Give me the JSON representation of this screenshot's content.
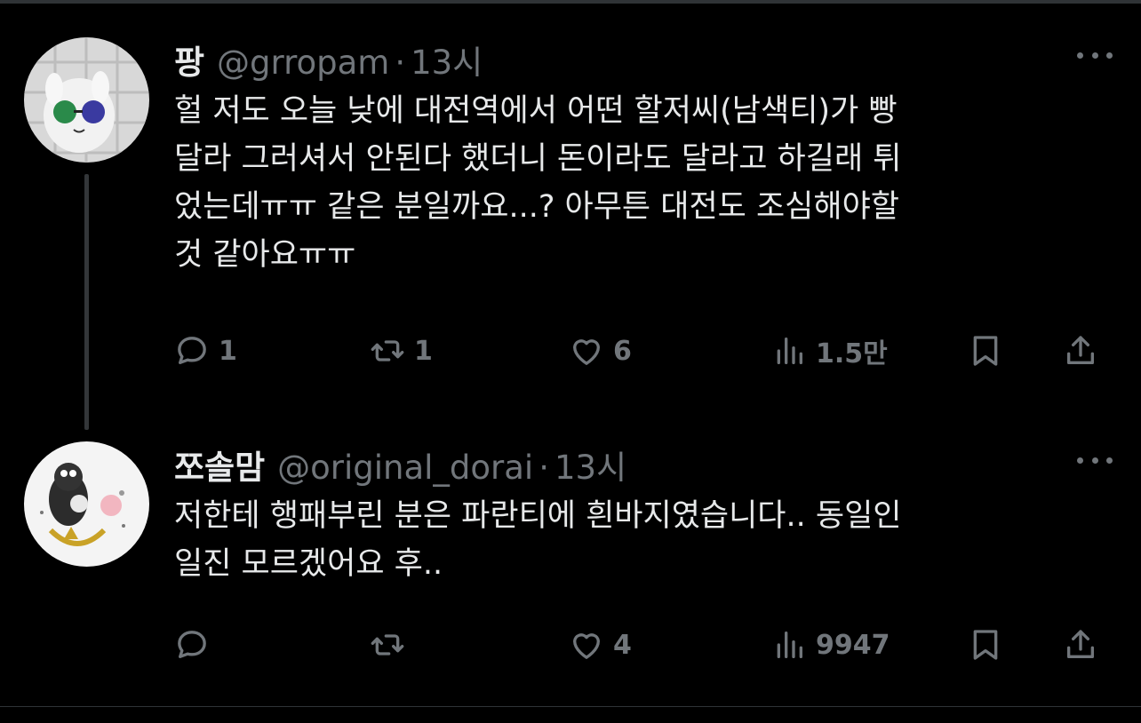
{
  "tweets": [
    {
      "name": "팡",
      "handle": "@grropam",
      "separator": "·",
      "time": "13시",
      "text": "헐 저도 오늘 낮에 대전역에서 어떤 할저씨(남색티)가 빵\n달라 그러셔서 안된다 했더니 돈이라도 달라고 하길래 튀\n었는데ㅠㅠ 같은 분일까요...? 아무튼 대전도 조심해야할\n것 같아요ㅠㅠ",
      "replies": "1",
      "retweets": "1",
      "likes": "6",
      "views": "1.5만"
    },
    {
      "name": "쪼솔맘",
      "handle": "@original_dorai",
      "separator": "·",
      "time": "13시",
      "text": "저한테 행패부린 분은 파란티에 흰바지였습니다.. 동일인\n일진 모르겠어요 후..",
      "replies": "",
      "retweets": "",
      "likes": "4",
      "views": "9947"
    }
  ],
  "icons": {
    "reply": "speech-bubble-icon",
    "retweet": "retweet-arrows-icon",
    "like": "heart-icon",
    "views": "bar-chart-icon",
    "bookmark": "bookmark-icon",
    "share": "share-upload-icon",
    "more": "more-dots-icon"
  },
  "colors": {
    "background": "#000000",
    "text": "#e7e9ea",
    "muted": "#71767b",
    "divider": "#2f3336"
  }
}
